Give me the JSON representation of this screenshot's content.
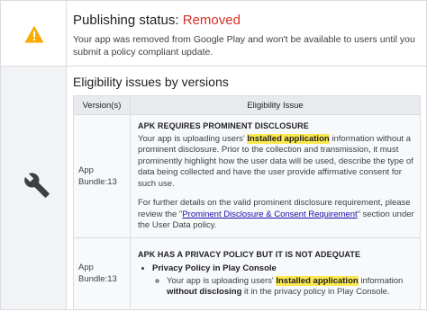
{
  "status": {
    "title_prefix": "Publishing status:",
    "title_value": "Removed",
    "description": "Your app was removed from Google Play and won't be available to users until you submit a policy compliant update.",
    "icon": "warning-icon",
    "value_color": "#d93025"
  },
  "issues": {
    "title": "Eligibility issues by versions",
    "icon": "wrench-icon",
    "columns": [
      "Version(s)",
      "Eligibility Issue"
    ],
    "rows": [
      {
        "version": "App Bundle:13",
        "heading": "APK REQUIRES PROMINENT DISCLOSURE",
        "p1_before": "Your app is uploading users'",
        "p1_highlight": "Installed application",
        "p1_after": "information without a prominent disclosure. Prior to the collection and transmission, it must prominently highlight how the user data will be used, describe the type of data being collected and have the user provide affirmative consent for such use.",
        "p2_before": "For further details on the valid prominent disclosure requirement, please review the \"",
        "p2_link": "Prominent Disclosure & Consent Requirement",
        "p2_after": "\" section under the User Data policy."
      },
      {
        "version": "App Bundle:13",
        "heading": "APK HAS A PRIVACY POLICY BUT IT IS NOT ADEQUATE",
        "bullet": "Privacy Policy in Play Console",
        "sub_before": "Your app is uploading users'",
        "sub_highlight": "Installed application",
        "sub_mid": "information",
        "sub_bold": "without disclosing",
        "sub_after": "it in the privacy policy in Play Console."
      }
    ]
  }
}
